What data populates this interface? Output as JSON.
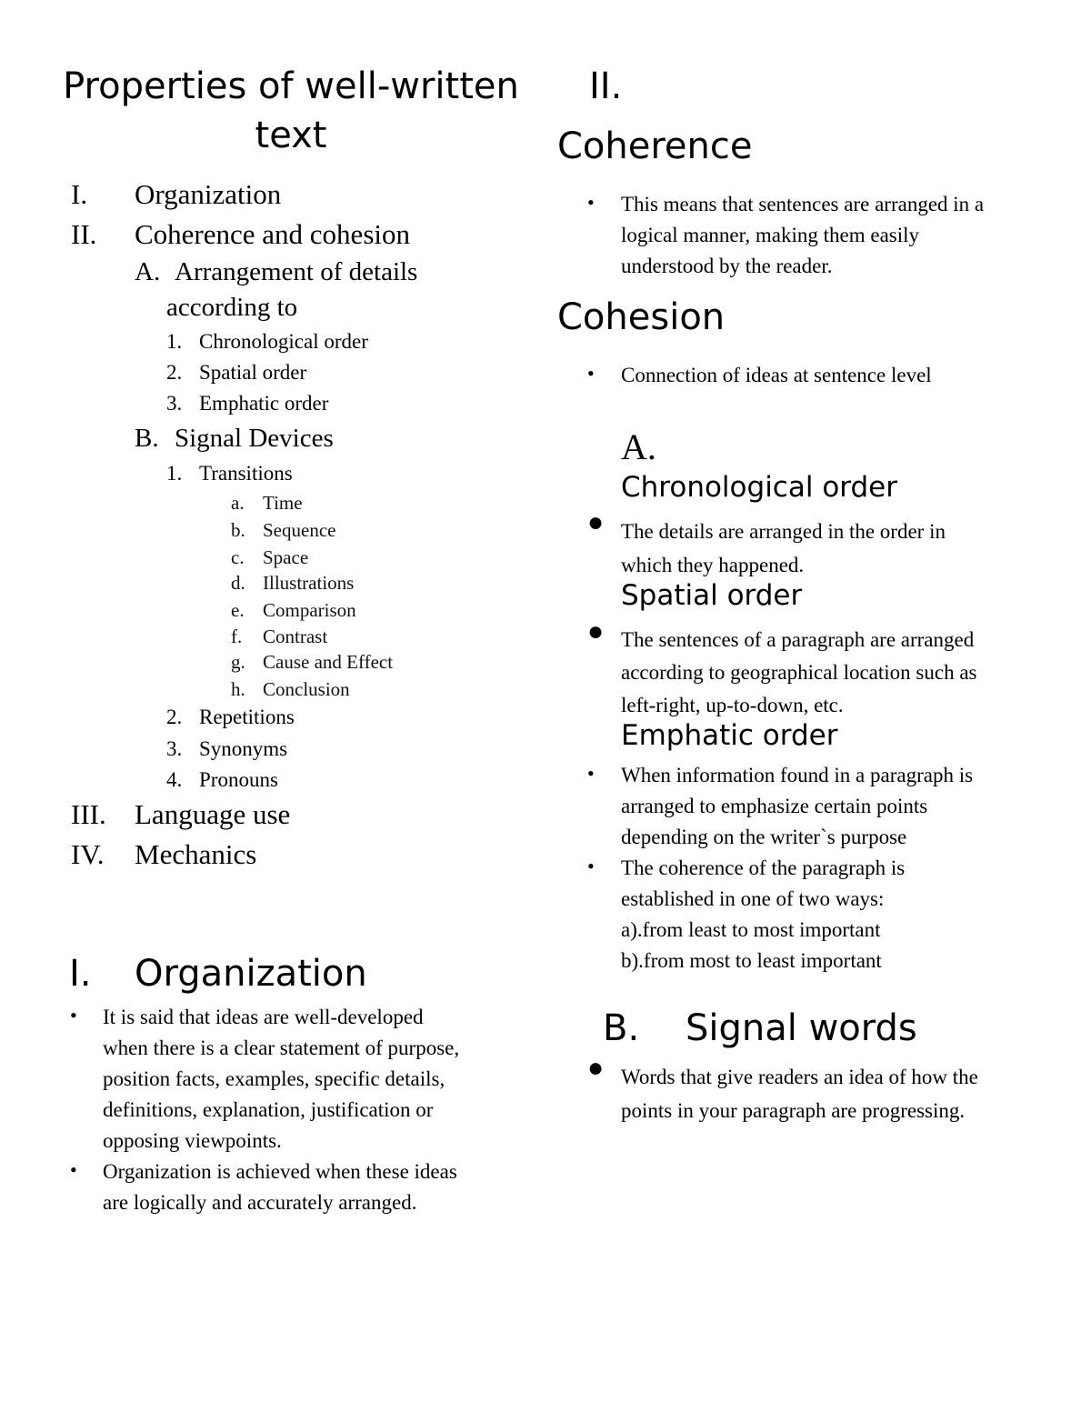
{
  "title": "Properties of well-written text",
  "outline": {
    "items": [
      {
        "num": "I.",
        "label": "Organization"
      },
      {
        "num": "II.",
        "label": "Coherence and cohesion"
      },
      {
        "num": "III.",
        "label": "Language use"
      },
      {
        "num": "IV.",
        "label": "Mechanics"
      }
    ],
    "sub_a": {
      "num": "A.",
      "label_line1": "Arrangement of details",
      "label_line2": "according to",
      "items": [
        {
          "num": "1.",
          "label": "Chronological order"
        },
        {
          "num": "2.",
          "label": "Spatial order"
        },
        {
          "num": "3.",
          "label": "Emphatic order"
        }
      ]
    },
    "sub_b": {
      "num": "B.",
      "label": "Signal Devices",
      "items": [
        {
          "num": "1.",
          "label": "Transitions"
        },
        {
          "num": "2.",
          "label": "Repetitions"
        },
        {
          "num": "3.",
          "label": "Synonyms"
        },
        {
          "num": "4.",
          "label": "Pronouns"
        }
      ],
      "transitions": [
        {
          "num": "a.",
          "label": "Time"
        },
        {
          "num": "b.",
          "label": "Sequence"
        },
        {
          "num": "c.",
          "label": "Space"
        },
        {
          "num": "d.",
          "label": "Illustrations"
        },
        {
          "num": "e.",
          "label": "Comparison"
        },
        {
          "num": "f.",
          "label": "Contrast"
        },
        {
          "num": "g.",
          "label": "Cause and Effect"
        },
        {
          "num": "h.",
          "label": "Conclusion"
        }
      ]
    }
  },
  "organization": {
    "num": "I.",
    "heading": "Organization",
    "bullets": [
      [
        "It is said that ideas are well-developed",
        "when there is a clear statement of purpose,",
        "position facts, examples, specific details,",
        "definitions, explanation, justification or",
        "opposing viewpoints."
      ],
      [
        "Organization is achieved when these ideas",
        "are logically and accurately arranged."
      ]
    ]
  },
  "right": {
    "num": "II.",
    "coherence": {
      "heading": "Coherence",
      "bullet": [
        "This means that sentences are arranged in a",
        "logical manner, making them easily",
        "understood by the reader."
      ]
    },
    "cohesion": {
      "heading": "Cohesion",
      "bullet": "Connection of ideas at sentence level"
    },
    "section_a": {
      "num": "A.",
      "chronological": {
        "heading": "Chronological order",
        "bullet": [
          "The details are arranged in the order in",
          "which they happened."
        ]
      },
      "spatial": {
        "heading": "Spatial order",
        "bullet": [
          "The sentences of a paragraph are arranged",
          "according to geographical location such as",
          "left-right, up-to-down, etc."
        ]
      },
      "emphatic": {
        "heading": "Emphatic order",
        "bullets": [
          [
            "When information found in a paragraph is",
            "arranged to emphasize certain points",
            "depending on the writer`s purpose"
          ],
          [
            "The coherence of the paragraph is",
            "established in one of two ways:",
            "a).from least to most important",
            "b).from most to least important"
          ]
        ]
      }
    },
    "section_b": {
      "num": "B.",
      "heading": "Signal words",
      "bullet": [
        "Words that give readers an idea of how the",
        "points in your paragraph are progressing."
      ]
    }
  }
}
